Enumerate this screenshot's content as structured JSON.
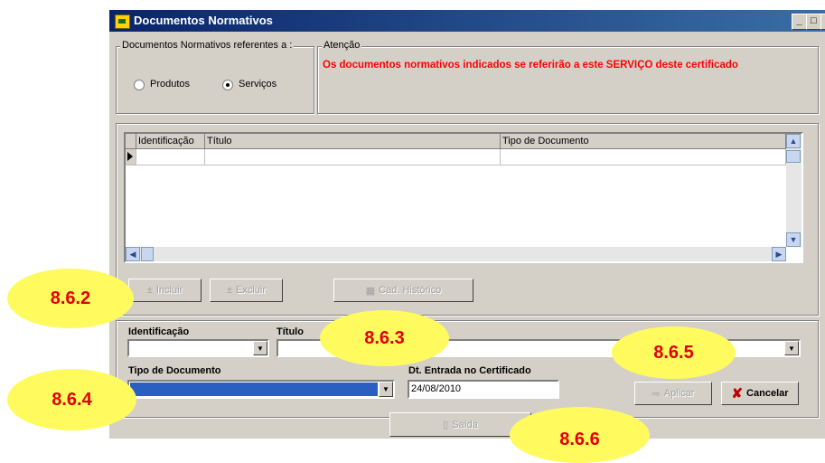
{
  "window": {
    "title": "Documentos Normativos",
    "controls": [
      "_",
      "□",
      "×"
    ]
  },
  "scope_group": {
    "label": "Documentos Normativos referentes a :",
    "options": [
      "Produtos",
      "Serviços"
    ],
    "selected": "Serviços"
  },
  "attention": {
    "label": "Atenção",
    "message": "Os documentos normativos indicados se referirão a este SERVIÇO deste certificado"
  },
  "grid": {
    "columns": [
      "Identificação",
      "Título",
      "Tipo de Documento"
    ],
    "rows": []
  },
  "buttons": {
    "incluir": "Incluir",
    "excluir": "Excluir",
    "cad_historico": "Cad. Histórico",
    "aplicar": "Aplicar",
    "cancelar": "Cancelar",
    "saida": "Saída"
  },
  "form": {
    "identificacao_label": "Identificação",
    "identificacao_value": "",
    "titulo_label": "Título",
    "titulo_value": "",
    "tipo_label": "Tipo de Documento",
    "tipo_value": "",
    "data_label": "Dt. Entrada no Certificado",
    "data_value": "24/08/2010"
  },
  "callouts": [
    "8.6.2",
    "8.6.3",
    "8.6.4",
    "8.6.5",
    "8.6.6"
  ],
  "colors": {
    "face": "#d4d0c8",
    "title_bar": "#0a246a",
    "alert_text": "#ff0000",
    "callout_fill": "#fffb5e",
    "callout_text": "#e00000",
    "selected_field": "#2a5fc2"
  }
}
